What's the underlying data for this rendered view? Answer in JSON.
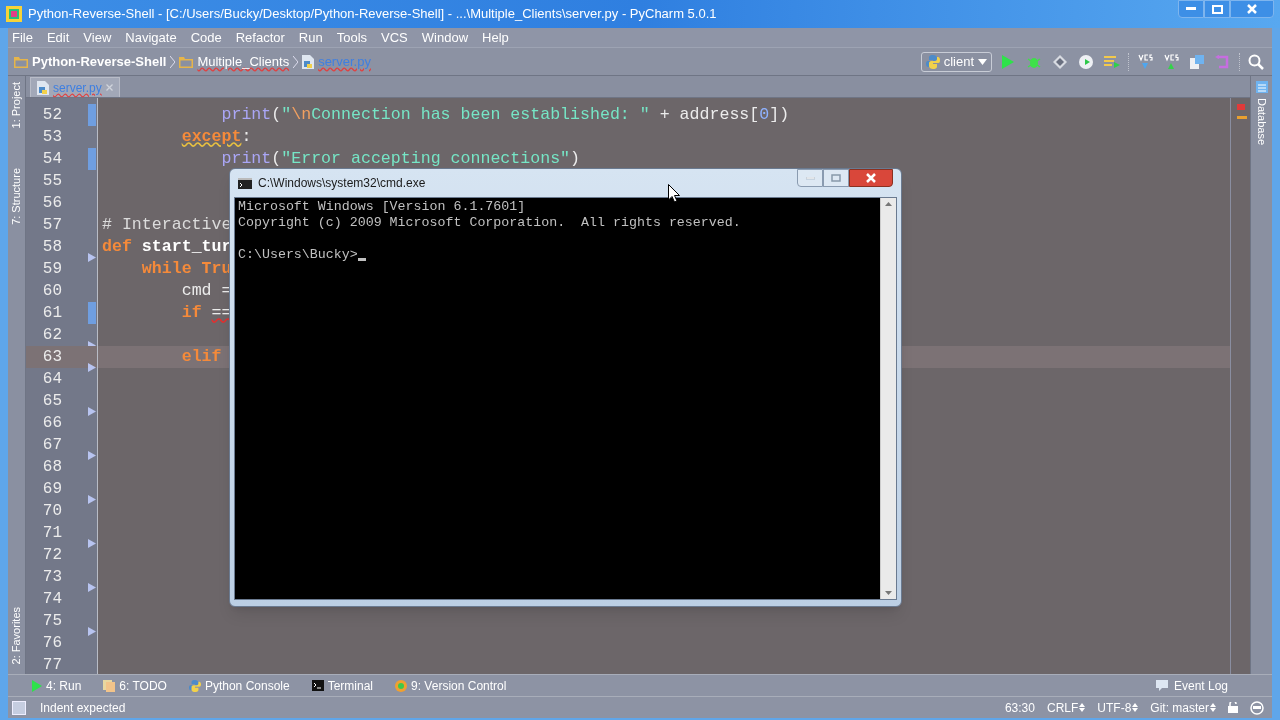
{
  "window": {
    "title": "Python-Reverse-Shell - [C:/Users/Bucky/Desktop/Python-Reverse-Shell] - ...\\Multiple_Clients\\server.py - PyCharm 5.0.1"
  },
  "menu": [
    "File",
    "Edit",
    "View",
    "Navigate",
    "Code",
    "Refactor",
    "Run",
    "Tools",
    "VCS",
    "Window",
    "Help"
  ],
  "breadcrumbs": [
    {
      "label": "Python-Reverse-Shell",
      "kind": "folder"
    },
    {
      "label": "Multiple_Clients",
      "kind": "folder"
    },
    {
      "label": "server.py",
      "kind": "file"
    }
  ],
  "run_config": "client",
  "tabs": [
    {
      "label": "server.py",
      "selected": true
    }
  ],
  "left_tools": [
    "1: Project",
    "7: Structure",
    "2: Favorites"
  ],
  "right_tools": [
    "Database"
  ],
  "editor": {
    "lines": [
      {
        "number": "52",
        "changed": true,
        "tokens": [
          {
            "text": "            print",
            "kind": "call"
          },
          {
            "text": "(",
            "kind": "plain"
          },
          {
            "text": "\"",
            "kind": "string"
          },
          {
            "text": "\\n",
            "kind": "escape"
          },
          {
            "text": "Connection has been established: \"",
            "kind": "string"
          },
          {
            "text": " + address[",
            "kind": "plain"
          },
          {
            "text": "0",
            "kind": "number"
          },
          {
            "text": "])",
            "kind": "plain"
          }
        ]
      },
      {
        "number": "53",
        "tokens": [
          {
            "text": "        except",
            "kind": "keyword",
            "warning_underline": true
          },
          {
            "text": ":",
            "kind": "plain"
          }
        ]
      },
      {
        "number": "54",
        "changed": true,
        "tokens": [
          {
            "text": "            print",
            "kind": "call"
          },
          {
            "text": "(",
            "kind": "plain"
          },
          {
            "text": "\"Error accepting connections\"",
            "kind": "string"
          },
          {
            "text": ")",
            "kind": "plain"
          }
        ]
      },
      {
        "number": "55"
      },
      {
        "number": "56"
      },
      {
        "number": "57",
        "tokens": [
          {
            "text": "# Interactive",
            "kind": "comment"
          }
        ]
      },
      {
        "number": "58",
        "fold": true,
        "tokens": [
          {
            "text": "def",
            "kind": "keyword"
          },
          {
            "text": " start_tur",
            "kind": "name"
          }
        ]
      },
      {
        "number": "59",
        "tokens": [
          {
            "text": "    while Tru",
            "kind": "keyword"
          }
        ]
      },
      {
        "number": "60",
        "tokens": [
          {
            "text": "        cmd =",
            "kind": "plain"
          }
        ]
      },
      {
        "number": "61",
        "changed": true,
        "tokens": [
          {
            "text": "        if",
            "kind": "keyword"
          },
          {
            "text": " ==",
            "kind": "plain",
            "error_underline": true
          }
        ]
      },
      {
        "number": "62",
        "fold": true
      },
      {
        "number": "63",
        "fold": true,
        "current": true,
        "tokens": [
          {
            "text": "        elif",
            "kind": "keyword"
          }
        ]
      },
      {
        "number": "64"
      },
      {
        "number": "65",
        "fold": true
      },
      {
        "number": "66"
      },
      {
        "number": "67",
        "fold": true
      },
      {
        "number": "68"
      },
      {
        "number": "69",
        "fold": true
      },
      {
        "number": "70"
      },
      {
        "number": "71",
        "fold": true
      },
      {
        "number": "72"
      },
      {
        "number": "73",
        "fold": true
      },
      {
        "number": "74"
      },
      {
        "number": "75",
        "fold": true
      },
      {
        "number": "76"
      },
      {
        "number": "77"
      }
    ]
  },
  "cmd_window": {
    "title": "C:\\Windows\\system32\\cmd.exe",
    "output": [
      "Microsoft Windows [Version 6.1.7601]",
      "Copyright (c) 2009 Microsoft Corporation.  All rights reserved."
    ],
    "prompt": "C:\\Users\\Bucky>",
    "cursor": true
  },
  "tool_windows": [
    {
      "label": "4: Run",
      "kind": "run"
    },
    {
      "label": "6: TODO",
      "kind": "todo"
    },
    {
      "label": "Python Console",
      "kind": "console"
    },
    {
      "label": "Terminal",
      "kind": "terminal"
    },
    {
      "label": "9: Version Control",
      "kind": "vcs"
    }
  ],
  "event_log": "Event Log",
  "status_bar": {
    "message": "Indent expected",
    "position": "63:30",
    "line_separator": "CRLF",
    "encoding": "UTF-8",
    "branch": "Git: master"
  }
}
